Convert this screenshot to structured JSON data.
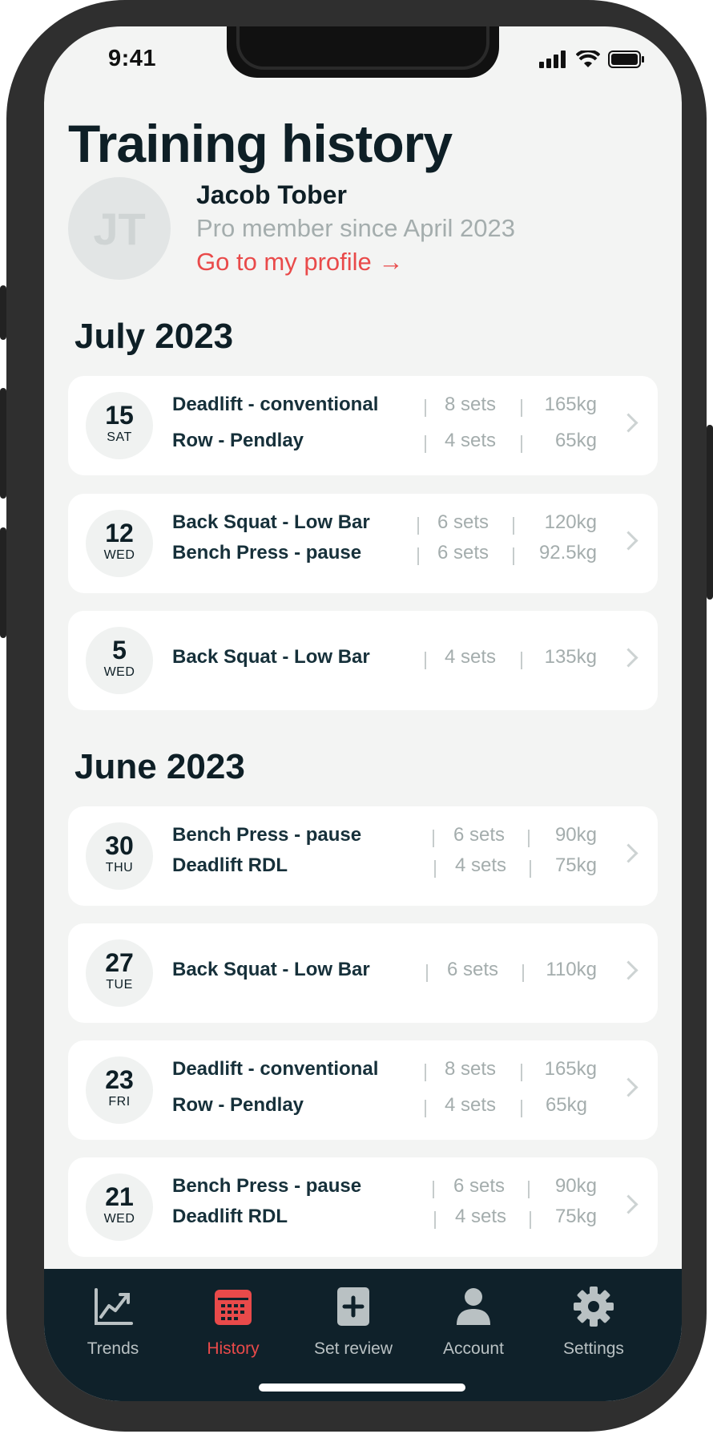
{
  "status_bar": {
    "time": "9:41"
  },
  "page_title": "Training history",
  "profile": {
    "initials": "JT",
    "name": "Jacob Tober",
    "membership": "Pro member since April 2023",
    "profile_link": "Go to my profile →"
  },
  "sections": [
    {
      "month": "July 2023",
      "sessions": [
        {
          "day": "15",
          "weekday": "SAT",
          "exercises": [
            {
              "name": "Deadlift - conventional",
              "sets": "8 sets",
              "weight": "165kg"
            },
            {
              "name": "Row - Pendlay",
              "sets": "4 sets",
              "weight": "65kg"
            }
          ]
        },
        {
          "day": "12",
          "weekday": "WED",
          "exercises": [
            {
              "name": "Back Squat - Low Bar",
              "sets": "6 sets",
              "weight": "120kg"
            },
            {
              "name": "Bench Press - pause",
              "sets": "6 sets",
              "weight": "92.5kg"
            }
          ]
        },
        {
          "day": "5",
          "weekday": "WED",
          "exercises": [
            {
              "name": "Back Squat - Low Bar",
              "sets": "4 sets",
              "weight": "135kg"
            }
          ]
        }
      ]
    },
    {
      "month": "June 2023",
      "sessions": [
        {
          "day": "30",
          "weekday": "THU",
          "exercises": [
            {
              "name": "Bench Press - pause",
              "sets": "6 sets",
              "weight": "90kg"
            },
            {
              "name": "Deadlift RDL",
              "sets": "4 sets",
              "weight": "75kg"
            }
          ]
        },
        {
          "day": "27",
          "weekday": "TUE",
          "exercises": [
            {
              "name": "Back Squat - Low Bar",
              "sets": "6 sets",
              "weight": "110kg"
            }
          ]
        },
        {
          "day": "23",
          "weekday": "FRI",
          "exercises": [
            {
              "name": "Deadlift - conventional",
              "sets": "8 sets",
              "weight": "165kg"
            },
            {
              "name": "Row - Pendlay",
              "sets": "4 sets",
              "weight": "65kg"
            }
          ]
        },
        {
          "day": "21",
          "weekday": "WED",
          "exercises": [
            {
              "name": "Bench Press - pause",
              "sets": "6 sets",
              "weight": "90kg"
            },
            {
              "name": "Deadlift RDL",
              "sets": "4 sets",
              "weight": "75kg"
            }
          ]
        }
      ]
    }
  ],
  "tab_bar": [
    {
      "label": "Trends",
      "icon": "trend-chart-icon",
      "active": false
    },
    {
      "label": "History",
      "icon": "calendar-icon",
      "active": true
    },
    {
      "label": "Set review",
      "icon": "add-square-icon",
      "active": false
    },
    {
      "label": "Account",
      "icon": "person-icon",
      "active": false
    },
    {
      "label": "Settings",
      "icon": "gear-icon",
      "active": false
    }
  ],
  "colors": {
    "accent": "#e94a4a",
    "tab_bar_bg": "#0f212a",
    "text_dark": "#0e1f26",
    "muted": "#a4adad"
  }
}
